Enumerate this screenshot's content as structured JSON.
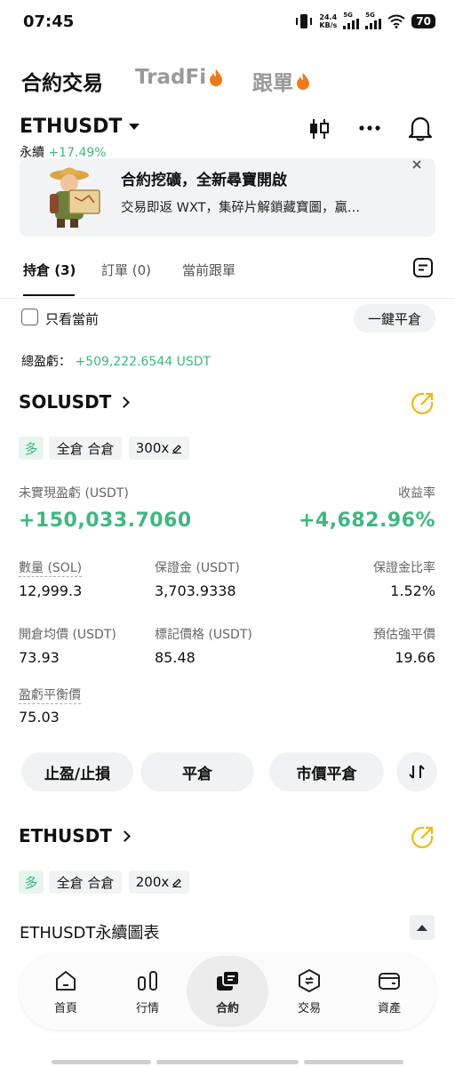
{
  "status_bar": {
    "time": "07:45",
    "net_speed_value": "24.4",
    "net_speed_unit": "KB/s",
    "signal1_label": "5G",
    "signal2_label": "5G",
    "battery": "70"
  },
  "top_tabs": [
    {
      "label": "合約交易",
      "active": true
    },
    {
      "label": "TradFi",
      "active": false,
      "fire": true
    },
    {
      "label": "跟單",
      "active": false,
      "fire": true
    }
  ],
  "symbol": {
    "name": "ETHUSDT",
    "type": "永續",
    "change": "+17.49%"
  },
  "banner": {
    "title": "合約挖礦，全新尋寶開啟",
    "body": "交易即返 WXT，集碎片解鎖藏寶圖，贏..."
  },
  "subtabs": [
    {
      "label": "持倉 (3)",
      "active": true
    },
    {
      "label": "訂單 (0)",
      "active": false
    },
    {
      "label": "當前跟單",
      "active": false
    }
  ],
  "filters": {
    "only_current_label": "只看當前",
    "close_all_label": "一鍵平倉"
  },
  "total_pnl": {
    "label": "總盈虧：",
    "value": "+509,222.6544 USDT"
  },
  "positions": [
    {
      "symbol": "SOLUSDT",
      "side": "多",
      "margin_mode": "全倉 合倉",
      "leverage": "300x",
      "unrealized_label": "未實現盈虧 (USDT)",
      "unrealized_value": "+150,033.7060",
      "roe_label": "收益率",
      "roe_value": "+4,682.96%",
      "qty_label": "數量 (SOL)",
      "qty_value": "12,999.3",
      "margin_label": "保證金 (USDT)",
      "margin_value": "3,703.9338",
      "margin_ratio_label": "保證金比率",
      "margin_ratio_value": "1.52%",
      "entry_label": "開倉均價 (USDT)",
      "entry_value": "73.93",
      "mark_label": "標記價格 (USDT)",
      "mark_value": "85.48",
      "liq_label": "預估強平價",
      "liq_value": "19.66",
      "breakeven_label": "盈虧平衡價",
      "breakeven_value": "75.03",
      "actions": [
        "止盈/止損",
        "平倉",
        "市價平倉"
      ]
    },
    {
      "symbol": "ETHUSDT",
      "side": "多",
      "margin_mode": "全倉 合倉",
      "leverage": "200x"
    }
  ],
  "chart_section": {
    "title": "ETHUSDT永續圖表"
  },
  "bottom_nav": [
    {
      "label": "首頁",
      "icon": "home-icon",
      "active": false
    },
    {
      "label": "行情",
      "icon": "market-icon",
      "active": false
    },
    {
      "label": "合約",
      "icon": "futures-icon",
      "active": true
    },
    {
      "label": "交易",
      "icon": "trade-icon",
      "active": false
    },
    {
      "label": "資產",
      "icon": "wallet-icon",
      "active": false
    }
  ],
  "colors": {
    "green": "#3db87f",
    "accent_yellow": "#f0b90b",
    "fire": "#f07a1a"
  }
}
